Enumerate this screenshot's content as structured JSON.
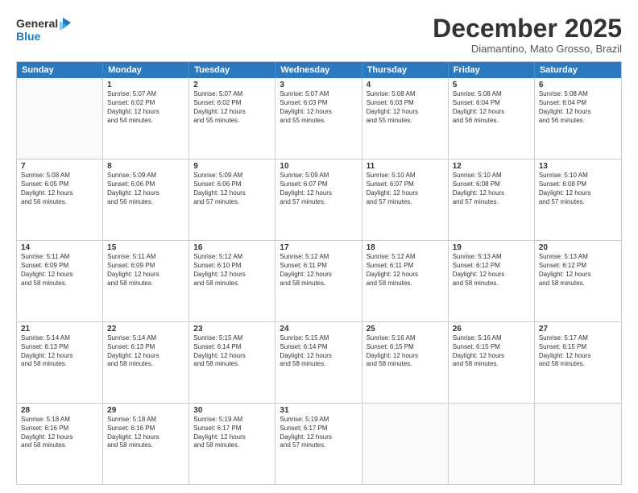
{
  "logo": {
    "line1": "General",
    "line2": "Blue"
  },
  "title": "December 2025",
  "location": "Diamantino, Mato Grosso, Brazil",
  "header_days": [
    "Sunday",
    "Monday",
    "Tuesday",
    "Wednesday",
    "Thursday",
    "Friday",
    "Saturday"
  ],
  "weeks": [
    [
      {
        "day": "",
        "text": ""
      },
      {
        "day": "1",
        "text": "Sunrise: 5:07 AM\nSunset: 6:02 PM\nDaylight: 12 hours\nand 54 minutes."
      },
      {
        "day": "2",
        "text": "Sunrise: 5:07 AM\nSunset: 6:02 PM\nDaylight: 12 hours\nand 55 minutes."
      },
      {
        "day": "3",
        "text": "Sunrise: 5:07 AM\nSunset: 6:03 PM\nDaylight: 12 hours\nand 55 minutes."
      },
      {
        "day": "4",
        "text": "Sunrise: 5:08 AM\nSunset: 6:03 PM\nDaylight: 12 hours\nand 55 minutes."
      },
      {
        "day": "5",
        "text": "Sunrise: 5:08 AM\nSunset: 6:04 PM\nDaylight: 12 hours\nand 56 minutes."
      },
      {
        "day": "6",
        "text": "Sunrise: 5:08 AM\nSunset: 6:04 PM\nDaylight: 12 hours\nand 56 minutes."
      }
    ],
    [
      {
        "day": "7",
        "text": "Sunrise: 5:08 AM\nSunset: 6:05 PM\nDaylight: 12 hours\nand 56 minutes."
      },
      {
        "day": "8",
        "text": "Sunrise: 5:09 AM\nSunset: 6:06 PM\nDaylight: 12 hours\nand 56 minutes."
      },
      {
        "day": "9",
        "text": "Sunrise: 5:09 AM\nSunset: 6:06 PM\nDaylight: 12 hours\nand 57 minutes."
      },
      {
        "day": "10",
        "text": "Sunrise: 5:09 AM\nSunset: 6:07 PM\nDaylight: 12 hours\nand 57 minutes."
      },
      {
        "day": "11",
        "text": "Sunrise: 5:10 AM\nSunset: 6:07 PM\nDaylight: 12 hours\nand 57 minutes."
      },
      {
        "day": "12",
        "text": "Sunrise: 5:10 AM\nSunset: 6:08 PM\nDaylight: 12 hours\nand 57 minutes."
      },
      {
        "day": "13",
        "text": "Sunrise: 5:10 AM\nSunset: 6:08 PM\nDaylight: 12 hours\nand 57 minutes."
      }
    ],
    [
      {
        "day": "14",
        "text": "Sunrise: 5:11 AM\nSunset: 6:09 PM\nDaylight: 12 hours\nand 58 minutes."
      },
      {
        "day": "15",
        "text": "Sunrise: 5:11 AM\nSunset: 6:09 PM\nDaylight: 12 hours\nand 58 minutes."
      },
      {
        "day": "16",
        "text": "Sunrise: 5:12 AM\nSunset: 6:10 PM\nDaylight: 12 hours\nand 58 minutes."
      },
      {
        "day": "17",
        "text": "Sunrise: 5:12 AM\nSunset: 6:11 PM\nDaylight: 12 hours\nand 58 minutes."
      },
      {
        "day": "18",
        "text": "Sunrise: 5:12 AM\nSunset: 6:11 PM\nDaylight: 12 hours\nand 58 minutes."
      },
      {
        "day": "19",
        "text": "Sunrise: 5:13 AM\nSunset: 6:12 PM\nDaylight: 12 hours\nand 58 minutes."
      },
      {
        "day": "20",
        "text": "Sunrise: 5:13 AM\nSunset: 6:12 PM\nDaylight: 12 hours\nand 58 minutes."
      }
    ],
    [
      {
        "day": "21",
        "text": "Sunrise: 5:14 AM\nSunset: 6:13 PM\nDaylight: 12 hours\nand 58 minutes."
      },
      {
        "day": "22",
        "text": "Sunrise: 5:14 AM\nSunset: 6:13 PM\nDaylight: 12 hours\nand 58 minutes."
      },
      {
        "day": "23",
        "text": "Sunrise: 5:15 AM\nSunset: 6:14 PM\nDaylight: 12 hours\nand 58 minutes."
      },
      {
        "day": "24",
        "text": "Sunrise: 5:15 AM\nSunset: 6:14 PM\nDaylight: 12 hours\nand 58 minutes."
      },
      {
        "day": "25",
        "text": "Sunrise: 5:16 AM\nSunset: 6:15 PM\nDaylight: 12 hours\nand 58 minutes."
      },
      {
        "day": "26",
        "text": "Sunrise: 5:16 AM\nSunset: 6:15 PM\nDaylight: 12 hours\nand 58 minutes."
      },
      {
        "day": "27",
        "text": "Sunrise: 5:17 AM\nSunset: 6:15 PM\nDaylight: 12 hours\nand 58 minutes."
      }
    ],
    [
      {
        "day": "28",
        "text": "Sunrise: 5:18 AM\nSunset: 6:16 PM\nDaylight: 12 hours\nand 58 minutes."
      },
      {
        "day": "29",
        "text": "Sunrise: 5:18 AM\nSunset: 6:16 PM\nDaylight: 12 hours\nand 58 minutes."
      },
      {
        "day": "30",
        "text": "Sunrise: 5:19 AM\nSunset: 6:17 PM\nDaylight: 12 hours\nand 58 minutes."
      },
      {
        "day": "31",
        "text": "Sunrise: 5:19 AM\nSunset: 6:17 PM\nDaylight: 12 hours\nand 57 minutes."
      },
      {
        "day": "",
        "text": ""
      },
      {
        "day": "",
        "text": ""
      },
      {
        "day": "",
        "text": ""
      }
    ]
  ]
}
